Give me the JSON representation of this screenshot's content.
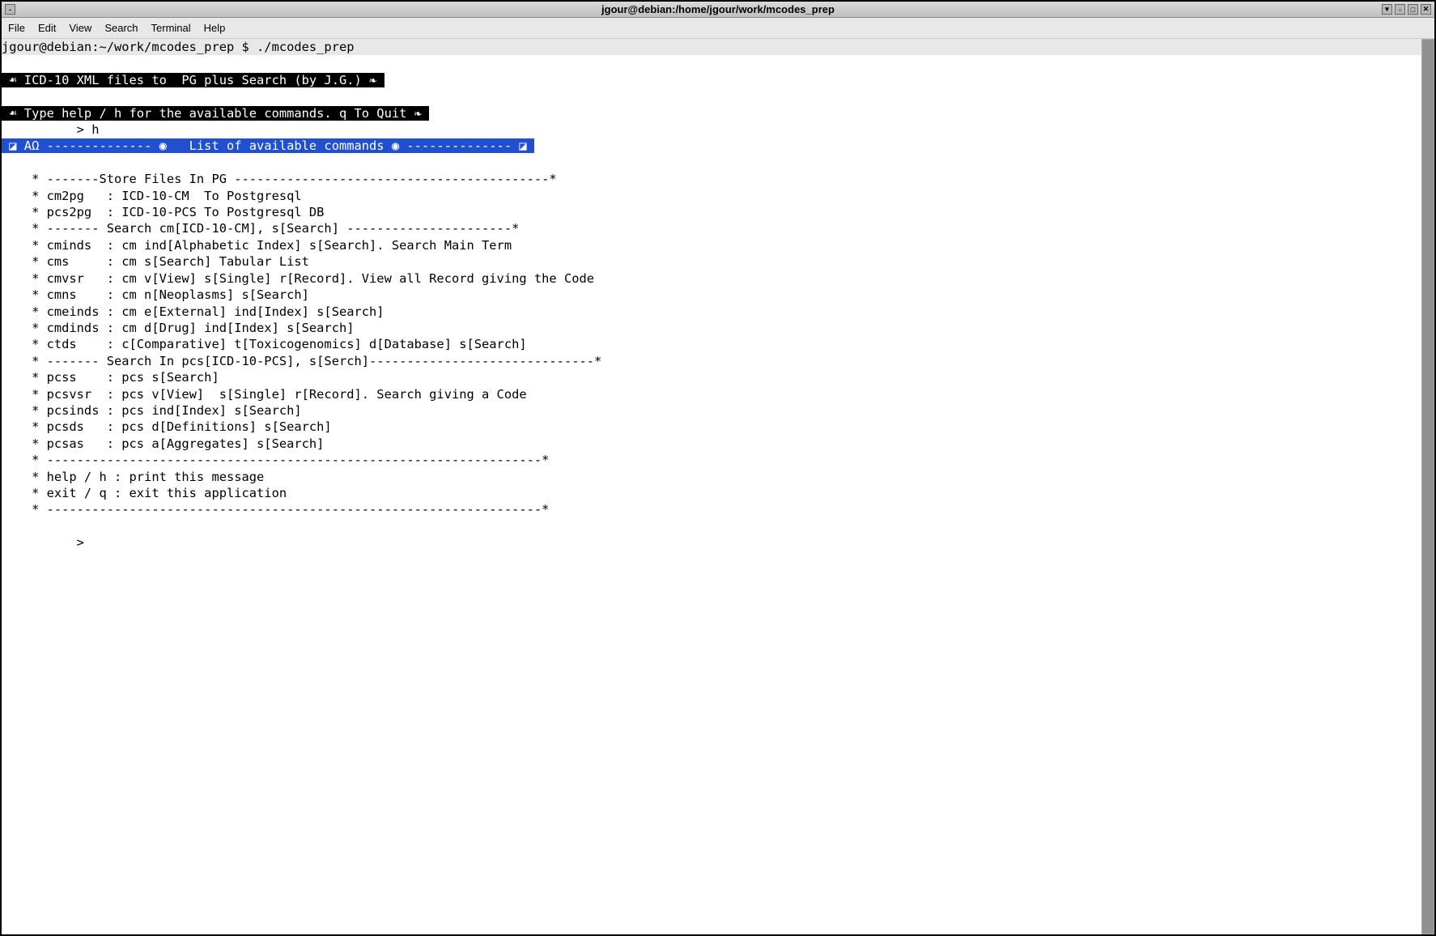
{
  "window": {
    "title": "jgour@debian:/home/jgour/work/mcodes_prep"
  },
  "menu": {
    "file": "File",
    "edit": "Edit",
    "view": "View",
    "search": "Search",
    "terminal": "Terminal",
    "help": "Help"
  },
  "terminal": {
    "prompt_line": "jgour@debian:~/work/mcodes_prep $ ./mcodes_prep",
    "banner1": " ☙ ICD-10 XML files to  PG plus Search (by J.G.) ❧ ",
    "banner2": " ☙ Type help / h for the available commands. q To Quit ❧ ",
    "input1": "          > h",
    "blue_header": " ◪ ΑΩ -------------- ◉   List of available commands ◉ -------------- ◪ ",
    "lines": [
      "",
      "    * -------Store Files In PG ------------------------------------------*",
      "    * cm2pg   : ICD-10-CM  To Postgresql",
      "    * pcs2pg  : ICD-10-PCS To Postgresql DB",
      "    * ------- Search cm[ICD-10-CM], s[Search] ----------------------*",
      "    * cminds  : cm ind[Alphabetic Index] s[Search]. Search Main Term",
      "    * cms     : cm s[Search] Tabular List",
      "    * cmvsr   : cm v[View] s[Single] r[Record]. View all Record giving the Code",
      "    * cmns    : cm n[Neoplasms] s[Search]",
      "    * cmeinds : cm e[External] ind[Index] s[Search]",
      "    * cmdinds : cm d[Drug] ind[Index] s[Search]",
      "    * ctds    : c[Comparative] t[Toxicogenomics] d[Database] s[Search]",
      "    * ------- Search In pcs[ICD-10-PCS], s[Serch]------------------------------*",
      "    * pcss    : pcs s[Search]",
      "    * pcsvsr  : pcs v[View]  s[Single] r[Record]. Search giving a Code",
      "    * pcsinds : pcs ind[Index] s[Search]",
      "    * pcsds   : pcs d[Definitions] s[Search]",
      "    * pcsas   : pcs a[Aggregates] s[Search]",
      "    * ------------------------------------------------------------------*",
      "    * help / h : print this message",
      "    * exit / q : exit this application",
      "    * ------------------------------------------------------------------*",
      "",
      "          > "
    ]
  }
}
